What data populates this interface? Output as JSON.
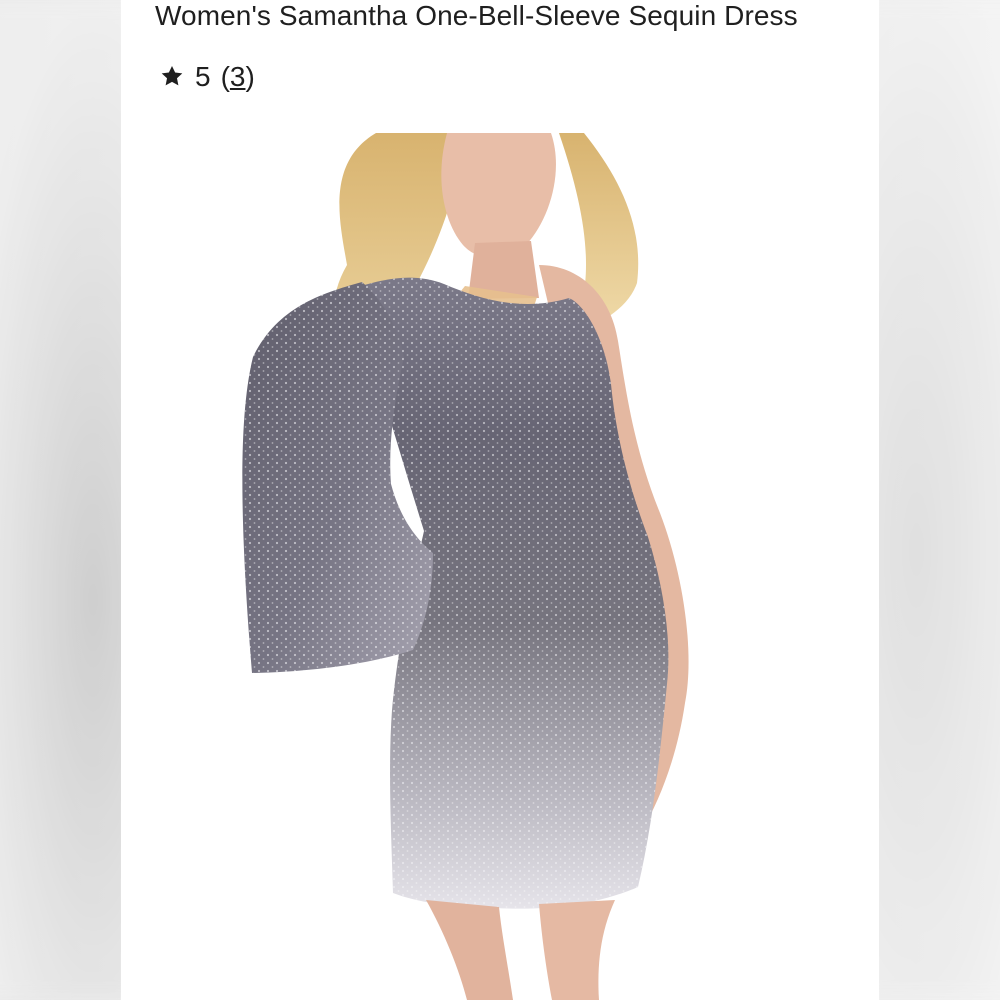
{
  "product": {
    "title": "Women's Samantha One-Bell-Sleeve Sequin Dress",
    "rating_value": "5",
    "review_count_open": "(",
    "review_count": "3",
    "review_count_close": ")"
  },
  "icons": {
    "rating_star": "star-icon"
  },
  "colors": {
    "text": "#1f1f1f",
    "dress_dark": "#5d5b67",
    "dress_light": "#d9d7df",
    "skin": "#e3b69f",
    "hair": "#e2c58a"
  }
}
